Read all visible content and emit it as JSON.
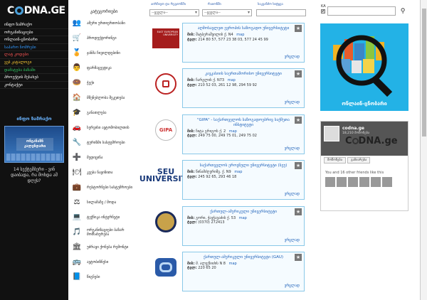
{
  "site": {
    "logo_text_1": "C",
    "logo_text_2": "DNA.GE"
  },
  "nav": [
    "ინფო ზამრაქო",
    "ორგანიზაციები",
    "ონლაინ-ცნობარი",
    "საპარო ნომრები",
    "ლატ კოდები",
    "ვებ კატალოგი",
    "დამატება ბაზაში",
    "პროექტის შესახებ",
    "კონტაქტი"
  ],
  "nav_colors": [
    "#fff",
    "#fff",
    "#fff",
    "#3399ff",
    "#ff5555",
    "#ffcc33",
    "#33cc66",
    "#fff",
    "#fff"
  ],
  "left_ad": {
    "title": "ინფო ზამრაქო",
    "image_text": "ონგანაზნ კალენდარი",
    "caption": "14 სექტემბერი - ვინ დაიბადა, რა მოხდა ამ დღეს?"
  },
  "categories": {
    "title": "კატეგორიები",
    "items": [
      {
        "icon": "👥",
        "label": "ამერი ურთიერთობანი"
      },
      {
        "icon": "🛒",
        "label": "პროდუქტორინგი"
      },
      {
        "icon": "🏅",
        "label": "ჯანმა ჩივილდებინი"
      },
      {
        "icon": "👨",
        "label": "ფარმაცევტიკა"
      },
      {
        "icon": "🍩",
        "label": "ჭექი"
      },
      {
        "icon": "🏠",
        "label": "მშენებლობა შეკეთება"
      },
      {
        "icon": "🎓",
        "label": "განათლება"
      },
      {
        "icon": "🚗",
        "label": "სერვისი ავტომობილთის"
      },
      {
        "icon": "🔧",
        "label": "ტურიზმი სასტუმროები"
      },
      {
        "icon": "➕",
        "label": "მედიცინა"
      },
      {
        "icon": "🍽",
        "label": "კვება ნაყინითა"
      },
      {
        "icon": "💼",
        "label": "რესტორნები სასტუმროები"
      },
      {
        "icon": "⚖",
        "label": "სილამაზე / მოდა"
      },
      {
        "icon": "💻",
        "label": "ტექნიკა ინტერნეტი"
      },
      {
        "icon": "🎵",
        "label": "ორგანიზაციები ბაზარ მომსახურება"
      },
      {
        "icon": "🏛",
        "label": "უძრავი ქონება რემონტი"
      },
      {
        "icon": "🚌",
        "label": "ავტობიზნესი"
      },
      {
        "icon": "📘",
        "label": "წიგნები"
      }
    ]
  },
  "filters": {
    "category_label": "აირჩიეთ და რეგიონში",
    "city_label": "რაიონში",
    "query_label": "საკვანძო სიტყვა",
    "category_value": "--ყველა--",
    "city_value": "--ყველა--"
  },
  "results": [
    {
      "logo": "eeu",
      "logo_text": "EAST EUROPEAN UNIVERSITY",
      "name": "აღმოსავლეთ ევროპის საზოგადო უნივერსიტეტი",
      "addr_label": "მის:",
      "addr": "შატბერაშვილის ქ. N4",
      "map": "map",
      "tel_label": "ტელ:",
      "tel": "214 80 57, 577 23 38 03, 577 24 45 99",
      "more": "ვრცლად"
    },
    {
      "logo": "circle-red",
      "logo_text": "",
      "name": "კავკასიის საერთაშორისო უნივერსიტეტი",
      "addr_label": "მის:",
      "addr": "ჩარგლის ქ. N73",
      "map": "map",
      "tel_label": "ტელ:",
      "tel": "210 52 03, 261 12 98, 294 59 92",
      "more": "ვრცლად"
    },
    {
      "logo": "gipa",
      "logo_text": "GIPA",
      "name": "\"GIPA\" - საქართველოს საზოგადოებრივ საქმეთა ინსტიტუტი",
      "addr_label": "მის:",
      "addr": "ჩიტა გრიგოს ქ. 2",
      "map": "map",
      "tel_label": "ტელ:",
      "tel": "249 75 00, 249 75 01, 249 75 02",
      "more": "ვრცლად"
    },
    {
      "logo": "seu",
      "logo_text": "SEU UNIVERSITY",
      "name": "საქართველოს ეროვნული უნივერსიტეტი (სეუ)",
      "addr_label": "მის:",
      "addr": "წინამძღვრიშვ. ქ. N9",
      "map": "map",
      "tel_label": "ტელ:",
      "tel": "245 92 65, 293 46 18",
      "more": "ვრცლად"
    },
    {
      "logo": "circle-gold",
      "logo_text": "",
      "name": "ქართულ-ამერიკული უნივერსიტეტი",
      "addr_label": "მის:",
      "addr": "გორი, ჭავჭავაძის ქ. 53",
      "map": "map",
      "tel_label": "ტელ:",
      "tel": "(0370) 272413",
      "more": "ვრცლად"
    },
    {
      "logo": "gau",
      "logo_text": "",
      "name": "ქართულ-ამერიკული უნივერსიტეტი (GAU)",
      "addr_label": "მის:",
      "addr": "მ. ალექსიძის N 8",
      "map": "map",
      "tel_label": "ტელ:",
      "tel": "220 65 20",
      "more": "ვრცლად"
    }
  ],
  "search": {
    "lang": "KA",
    "check": "✔"
  },
  "banner": {
    "text": "ონლაინ-ცნობარი"
  },
  "facebook": {
    "name": "codna.ge",
    "likes": "18,210 მოწონება",
    "brand_1": "C",
    "brand_2": "DNA.ge",
    "like_btn": "მოწონება",
    "share_btn": "გაზიარება",
    "friends": "You and 16 other friends like this"
  }
}
